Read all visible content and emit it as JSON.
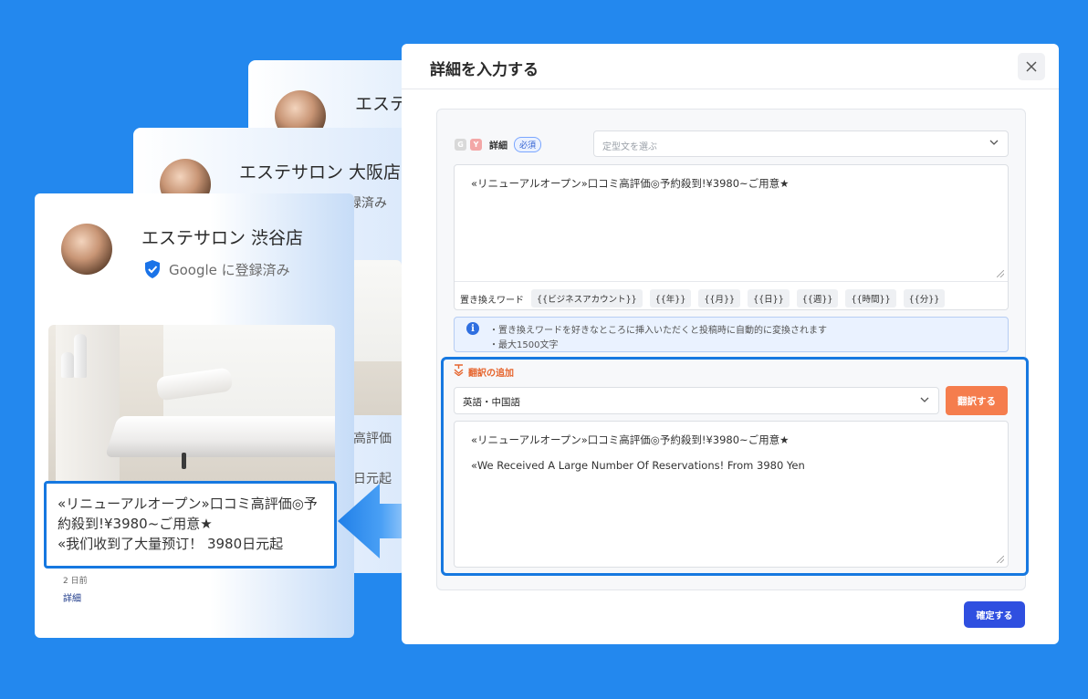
{
  "cards": {
    "back2": {
      "shop_name": "エステサロン"
    },
    "back1": {
      "shop_name": "エステサロン 大阪店",
      "registered_partial": "録済み",
      "text1": "高評価",
      "text2": "日元起"
    },
    "front": {
      "shop_name": "エステサロン 渋谷店",
      "registered": "Google に登録済み",
      "post_lines": [
        "«リニューアルオープン»口コミ高評価◎予",
        "約殺到!¥3980~ご用意★",
        "«我们收到了大量预订！ 3980日元起"
      ],
      "time_ago": "2 日前",
      "detail_link": "詳細"
    }
  },
  "modal": {
    "title": "詳細を入力する",
    "close_icon": "close-icon",
    "detail_label": "詳細",
    "required_badge": "必須",
    "g_badge": "G",
    "y_badge": "Y",
    "template_placeholder": "定型文を選ぶ",
    "detail_text": "«リニューアルオープン»口コミ高評価◎予約殺到!¥3980~ご用意★",
    "replace_label": "置き換えワード",
    "replace_chips": [
      "{{ビジネスアカウント}}",
      "{{年}}",
      "{{月}}",
      "{{日}}",
      "{{週}}",
      "{{時間}}",
      "{{分}}"
    ],
    "info_lines": [
      "・置き換えワードを好きなところに挿入いただくと投稿時に自動的に変換されます",
      "・最大1500文字"
    ],
    "translation_label": "翻訳の追加",
    "language_value": "英語・中国語",
    "translate_button": "翻訳する",
    "translation_lines": [
      "«リニューアルオープン»口コミ高評価◎予約殺到!¥3980~ご用意★",
      "«We Received A Large Number Of Reservations! From 3980 Yen"
    ],
    "confirm_button": "確定する"
  },
  "colors": {
    "background": "#2388ee",
    "highlight": "#1678e0",
    "translate_button": "#f57d4d",
    "confirm_button": "#2f4fe0",
    "required_badge": "#2f5fd0"
  }
}
